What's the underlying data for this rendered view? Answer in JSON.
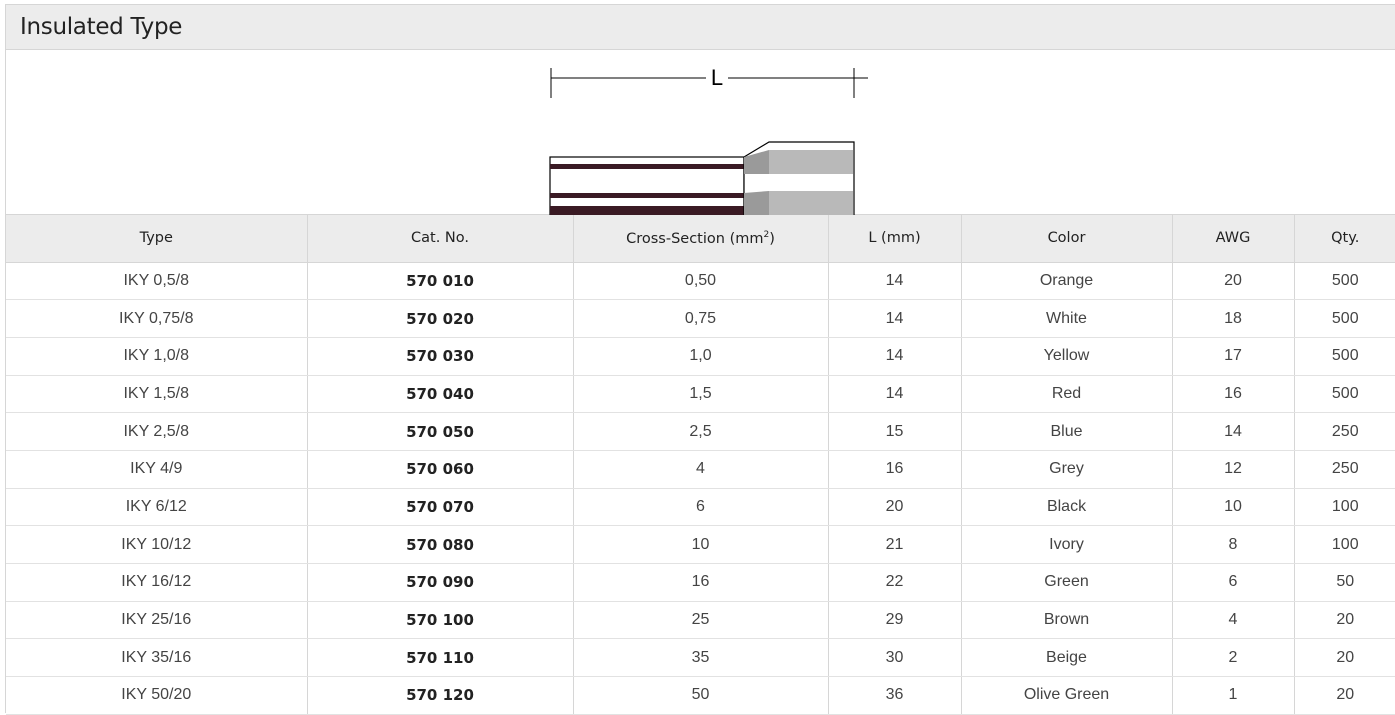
{
  "section": {
    "title": "Insulated Type"
  },
  "diagram": {
    "dimension_label": "L",
    "colors": {
      "line": "#000000",
      "stripe": "#3a1a24",
      "collar_fill": "#b9b9b9"
    }
  },
  "table": {
    "headers": {
      "type": "Type",
      "cat_no": "Cat. No.",
      "cross_section": "Cross-Section (mm",
      "cross_section_sup": "2",
      "cross_section_close": ")",
      "length": "L (mm)",
      "color": "Color",
      "awg": "AWG",
      "qty": "Qty."
    },
    "rows": [
      {
        "type": "IKY 0,5/8",
        "cat_no": "570 010",
        "cross_section": "0,50",
        "length": "14",
        "color": "Orange",
        "awg": "20",
        "qty": "500"
      },
      {
        "type": "IKY 0,75/8",
        "cat_no": "570 020",
        "cross_section": "0,75",
        "length": "14",
        "color": "White",
        "awg": "18",
        "qty": "500"
      },
      {
        "type": "IKY 1,0/8",
        "cat_no": "570 030",
        "cross_section": "1,0",
        "length": "14",
        "color": "Yellow",
        "awg": "17",
        "qty": "500"
      },
      {
        "type": "IKY 1,5/8",
        "cat_no": "570 040",
        "cross_section": "1,5",
        "length": "14",
        "color": "Red",
        "awg": "16",
        "qty": "500"
      },
      {
        "type": "IKY 2,5/8",
        "cat_no": "570 050",
        "cross_section": "2,5",
        "length": "15",
        "color": "Blue",
        "awg": "14",
        "qty": "250"
      },
      {
        "type": "IKY 4/9",
        "cat_no": "570 060",
        "cross_section": "4",
        "length": "16",
        "color": "Grey",
        "awg": "12",
        "qty": "250"
      },
      {
        "type": "IKY 6/12",
        "cat_no": "570 070",
        "cross_section": "6",
        "length": "20",
        "color": "Black",
        "awg": "10",
        "qty": "100"
      },
      {
        "type": "IKY 10/12",
        "cat_no": "570 080",
        "cross_section": "10",
        "length": "21",
        "color": "Ivory",
        "awg": "8",
        "qty": "100"
      },
      {
        "type": "IKY 16/12",
        "cat_no": "570 090",
        "cross_section": "16",
        "length": "22",
        "color": "Green",
        "awg": "6",
        "qty": "50"
      },
      {
        "type": "IKY 25/16",
        "cat_no": "570 100",
        "cross_section": "25",
        "length": "29",
        "color": "Brown",
        "awg": "4",
        "qty": "20"
      },
      {
        "type": "IKY 35/16",
        "cat_no": "570 110",
        "cross_section": "35",
        "length": "30",
        "color": "Beige",
        "awg": "2",
        "qty": "20"
      },
      {
        "type": "IKY 50/20",
        "cat_no": "570 120",
        "cross_section": "50",
        "length": "36",
        "color": "Olive Green",
        "awg": "1",
        "qty": "20"
      }
    ]
  }
}
